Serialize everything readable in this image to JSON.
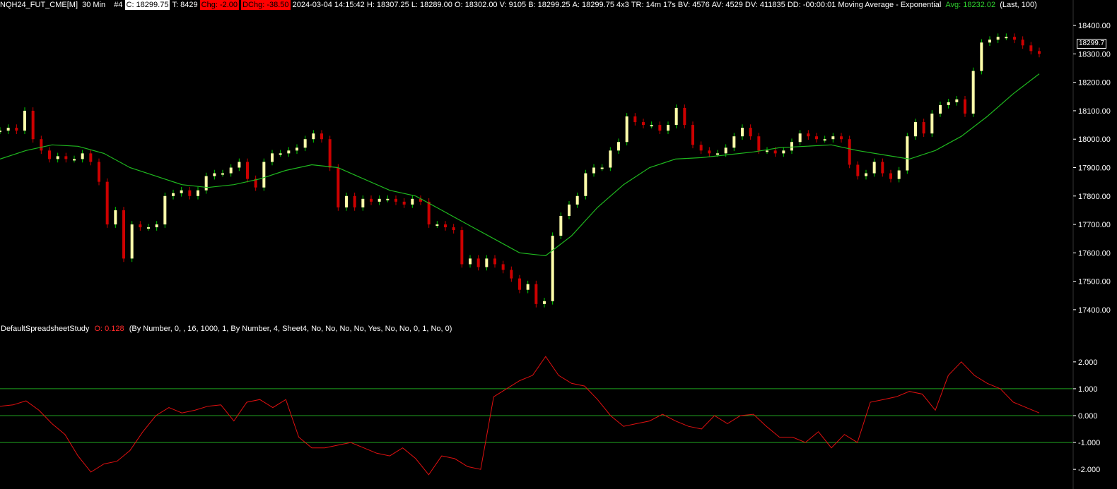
{
  "header": {
    "symbol": "NQH24_FUT_CME[M]",
    "interval": "30 Min",
    "chart_num": "#4",
    "close": "C: 18299.75",
    "trades": "T: 8429",
    "change": "Chg: -2.00",
    "daily_change": "DChg: -38.50",
    "datetime": "2024-03-04 14:15:42",
    "high": "H: 18307.25",
    "low": "L: 18289.00",
    "open": "O: 18302.00",
    "volume": "V: 9105",
    "bid": "B: 18299.25",
    "ask": "A: 18299.75",
    "bidask_size": "4x3",
    "time_remaining": "TR: 14m 17s",
    "bid_volume": "BV: 4576",
    "ask_volume": "AV: 4529",
    "delta_volume": "DV: 411835",
    "dd": "DD: -00:00:01",
    "study_name": "Moving Average - Exponential",
    "avg_label": "Avg: 18232.02",
    "study_params": "(Last, 100)"
  },
  "price_tag": "18299.7",
  "study": {
    "name": "DefaultSpreadsheetStudy",
    "value": "O: 0.128",
    "params": "(By Number, 0, , 16, 1000, 1, By Number, 4, Sheet4, No, No, No, No, Yes, No, No, 0, 1, No, 0)"
  },
  "colors": {
    "background": "#000000",
    "up_bar": "#ffffaa",
    "up_wick": "#00cc00",
    "down_bar": "#cc0000",
    "ema": "#1fb81f",
    "oscillator": "#e01010",
    "levels": "#1fa01f",
    "axis_text": "#ffffff"
  },
  "chart_data": [
    {
      "type": "line",
      "title": "",
      "series": [
        {
          "name": "",
          "values": [
            18030,
            18040,
            18030,
            18100,
            18000,
            17960,
            17930,
            17940,
            17930,
            17930,
            17950,
            17920,
            17850,
            17700,
            17750,
            17580,
            17700,
            17690,
            17690,
            17700,
            17800,
            17810,
            17820,
            17800,
            17820,
            17870,
            17880,
            17880,
            17900,
            17920,
            17860,
            17830,
            17920,
            17950,
            17950,
            17960,
            17970,
            18000,
            18020,
            18000,
            17900,
            17760,
            17800,
            17760,
            17790,
            17780,
            17790,
            17790,
            17780,
            17770,
            17790,
            17780,
            17700,
            17700,
            17690,
            17680,
            17560,
            17580,
            17550,
            17580,
            17560,
            17540,
            17510,
            17470,
            17490,
            17420,
            17430,
            17660,
            17730,
            17770,
            17800,
            17880,
            17900,
            17900,
            17960,
            17990,
            18080,
            18060,
            18050,
            18050,
            18030,
            18050,
            18110,
            18050,
            17980,
            17960,
            17950,
            17950,
            17970,
            18010,
            18040,
            18010,
            17960,
            17960,
            17950,
            17960,
            17990,
            18020,
            18010,
            18000,
            18000,
            18010,
            18000,
            17910,
            17870,
            17880,
            17920,
            17880,
            17860,
            17890,
            18010,
            18060,
            18020,
            18090,
            18120,
            18130,
            18140,
            18090,
            18240,
            18340,
            18350,
            18360,
            18360,
            18350,
            18330,
            18310,
            18300
          ]
        },
        {
          "name": "",
          "values": [
            17930,
            17960,
            17980,
            17975,
            17950,
            17900,
            17870,
            17840,
            17830,
            17840,
            17860,
            17890,
            17910,
            17900,
            17860,
            17820,
            17800,
            17750,
            17700,
            17650,
            17600,
            17590,
            17660,
            17760,
            17840,
            17900,
            17930,
            17935,
            17945,
            17955,
            17970,
            17975,
            17980,
            17960,
            17945,
            17930,
            17960,
            18010,
            18080,
            18160,
            18230
          ]
        }
      ],
      "ylim": [
        17360,
        18440
      ],
      "y_ticks": [
        "18400.00",
        "18300.00",
        "18200.00",
        "18100.00",
        "18000.00",
        "17900.00",
        "17800.00",
        "17700.00",
        "17600.00",
        "17500.00",
        "17400.00"
      ]
    },
    {
      "type": "line",
      "title": "",
      "series": [
        {
          "name": "",
          "values": [
            0.35,
            0.4,
            0.55,
            0.2,
            -0.3,
            -0.7,
            -1.5,
            -2.1,
            -1.8,
            -1.7,
            -1.3,
            -0.6,
            0.0,
            0.3,
            0.1,
            0.2,
            0.35,
            0.4,
            -0.2,
            0.5,
            0.6,
            0.3,
            0.6,
            -0.8,
            -1.2,
            -1.2,
            -1.1,
            -1.0,
            -1.2,
            -1.4,
            -1.5,
            -1.2,
            -1.6,
            -2.2,
            -1.5,
            -1.6,
            -1.9,
            -2.0,
            0.7,
            1.0,
            1.3,
            1.5,
            2.2,
            1.5,
            1.2,
            1.1,
            0.6,
            0.0,
            -0.4,
            -0.3,
            -0.2,
            0.05,
            -0.2,
            -0.4,
            -0.5,
            0.0,
            -0.3,
            0.0,
            0.05,
            -0.4,
            -0.8,
            -0.8,
            -1.0,
            -0.6,
            -1.2,
            -0.7,
            -1.0,
            0.5,
            0.6,
            0.7,
            0.9,
            0.8,
            0.2,
            1.5,
            2.0,
            1.5,
            1.2,
            1.0,
            0.5,
            0.3,
            0.1
          ]
        }
      ],
      "ylim": [
        -2.6,
        2.6
      ],
      "levels": [
        1.0,
        0.0,
        -1.0
      ],
      "y_ticks": [
        "2.000",
        "1.000",
        "0.000",
        "-1.000",
        "-2.000"
      ]
    }
  ]
}
